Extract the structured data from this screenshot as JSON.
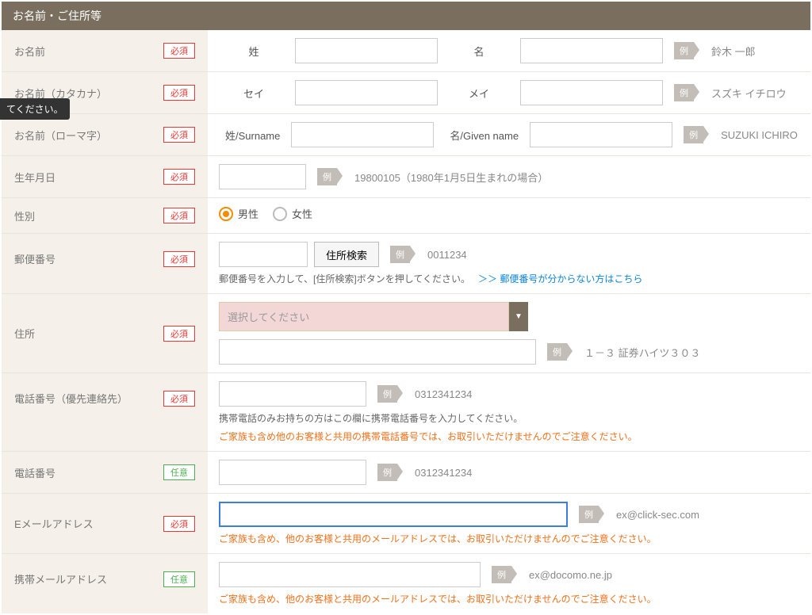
{
  "section_title": "お名前・ご住所等",
  "badges": {
    "required": "必須",
    "optional": "任意"
  },
  "example_label": "例",
  "tooltip_fragment": "てください。",
  "rows": {
    "name": {
      "label": "お名前",
      "sei": "姓",
      "mei": "名",
      "example": "鈴木 一郎"
    },
    "kana": {
      "label": "お名前（カタカナ）",
      "sei": "セイ",
      "mei": "メイ",
      "example": "スズキ イチロウ"
    },
    "roman": {
      "label": "お名前（ローマ字）",
      "sei": "姓/Surname",
      "mei": "名/Given name",
      "example": "SUZUKI ICHIRO"
    },
    "dob": {
      "label": "生年月日",
      "example": "19800105（1980年1月5日生まれの場合）"
    },
    "gender": {
      "label": "性別",
      "male": "男性",
      "female": "女性"
    },
    "zip": {
      "label": "郵便番号",
      "search_btn": "住所検索",
      "example": "0011234",
      "hint": "郵便番号を入力して、[住所検索]ボタンを押してください。",
      "link": "＞＞ 郵便番号が分からない方はこちら"
    },
    "addr": {
      "label": "住所",
      "select_placeholder": "選択してください",
      "example": "１－３ 証券ハイツ３０３"
    },
    "phone1": {
      "label": "電話番号（優先連絡先）",
      "example": "0312341234",
      "hint1": "携帯電話のみお持ちの方はこの欄に携帯電話番号を入力してください。",
      "hint2": "ご家族も含め他のお客様と共用の携帯電話番号では、お取引いただけませんのでご注意ください。"
    },
    "phone2": {
      "label": "電話番号",
      "example": "0312341234"
    },
    "email": {
      "label": "Eメールアドレス",
      "example": "ex@click-sec.com",
      "hint": "ご家族も含め、他のお客様と共用のメールアドレスでは、お取引いただけませんのでご注意ください。"
    },
    "memail": {
      "label": "携帯メールアドレス",
      "example": "ex@docomo.ne.jp",
      "hint": "ご家族も含め、他のお客様と共用のメールアドレスでは、お取引いただけませんのでご注意ください。"
    }
  }
}
